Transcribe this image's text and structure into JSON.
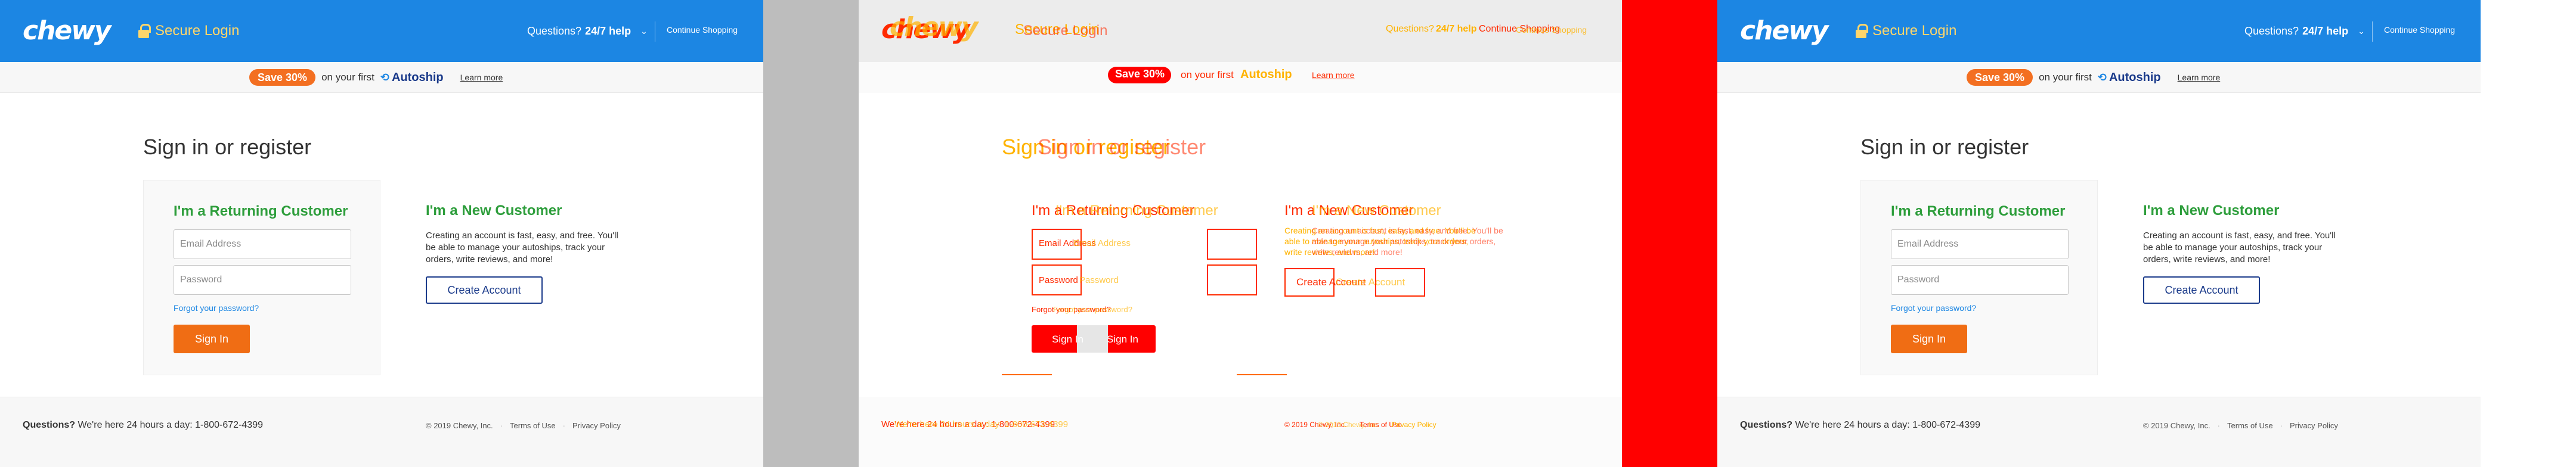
{
  "brand": {
    "logo": "chewy",
    "secure_label": "Secure Login",
    "colors": {
      "header_blue": "#1c86e3",
      "accent_orange": "#f06d14",
      "title_green": "#2e9e3c",
      "navy": "#1a3a8a",
      "diff_red": "#ff0000",
      "diff_gray": "#bdbdbd"
    }
  },
  "header": {
    "questions_label": "Questions?",
    "help_label": "24/7 help",
    "chevron_icon": "chevron-down-icon",
    "continue_label": "Continue Shopping"
  },
  "promo": {
    "badge": "Save 30%",
    "text": "on your first",
    "autoship": "Autoship",
    "learn_more": "Learn more"
  },
  "page": {
    "title": "Sign in or register"
  },
  "returning": {
    "title": "I'm a Returning Customer",
    "email_placeholder": "Email Address",
    "password_placeholder": "Password",
    "forgot": "Forgot your password?",
    "signin_button": "Sign In"
  },
  "new_customer": {
    "title": "I'm a New Customer",
    "description": "Creating an account is fast, easy, and free. You'll be able to manage your autoships, track your orders, write reviews, and more!",
    "create_button": "Create Account"
  },
  "footer": {
    "questions_bold": "Questions?",
    "questions_text": "We're here 24 hours a day: 1-800-672-4399",
    "copyright": "© 2019 Chewy, Inc.",
    "terms": "Terms of Use",
    "privacy": "Privacy Policy"
  }
}
